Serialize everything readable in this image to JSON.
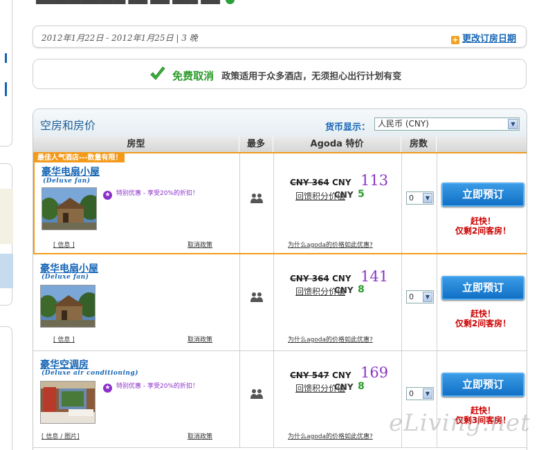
{
  "top_strip": {
    "text": "██████████████ ███ ███ ████ ███"
  },
  "booking": {
    "date_range": "2012年1月22日 - 2012年1月25日 | 3 晚",
    "change_date_label": "更改订房日期"
  },
  "cancellation": {
    "title": "免费取消",
    "description": "政策适用于众多酒店，无须担心出行计划有变"
  },
  "rooms_panel": {
    "title": "空房和房价",
    "currency_label": "货币显示：",
    "currency_value": "人民币 (CNY)",
    "columns": [
      "房型",
      "最多",
      "Agoda 特价",
      "房数"
    ]
  },
  "rooms": [
    {
      "banner": "最佳人气酒店---数量有限！",
      "name": "豪华电扇小屋",
      "name_en": "(Deluxe fan)",
      "promo": "特别优惠 - 享受20%的折扣！",
      "info": "[ 信息 ]",
      "policy": "取消政策",
      "old_price_currency": "CNY",
      "old_price": "364",
      "price_currency": "CNY",
      "price": "113",
      "reward_label": "回馈积分价值",
      "reward_unit": "CNY",
      "reward_value": "5",
      "why_link": "为什么agoda的价格如此优惠?",
      "qty": "0",
      "book_label": "立即预订",
      "hurry_1": "赶快！",
      "hurry_2": "仅剩2间客房！"
    },
    {
      "name": "豪华电扇小屋",
      "name_en": "(Deluxe fan)",
      "info": "[ 信息 ]",
      "policy": "取消政策",
      "old_price_currency": "CNY",
      "old_price": "364",
      "price_currency": "CNY",
      "price": "141",
      "reward_label": "回馈积分价值",
      "reward_unit": "CNY",
      "reward_value": "8",
      "why_link": "为什么agoda的价格如此优惠?",
      "qty": "0",
      "book_label": "立即预订",
      "hurry_1": "赶快！",
      "hurry_2": "仅剩2间客房！"
    },
    {
      "name": "豪华空调房",
      "name_en": "(Deluxe air conditioning)",
      "promo": "特别优惠 - 享受20%的折扣！",
      "info": "[ 信息 / 图片]",
      "policy": "取消政策",
      "old_price_currency": "CNY",
      "old_price": "547",
      "price_currency": "CNY",
      "price": "169",
      "reward_label": "回馈积分价值",
      "reward_unit": "CNY",
      "reward_value": "8",
      "why_link": "为什么agoda的价格如此优惠?",
      "qty": "0",
      "book_label": "立即预订",
      "hurry_1": "赶快！",
      "hurry_2": "仅剩3间客房！"
    }
  ],
  "watermark": "eLiving.net",
  "colors": {
    "accent": "#1464b4",
    "featured_border": "#f39a1a",
    "price": "#8a35c6",
    "reward": "#2a9a2a",
    "urgent": "#cc0000"
  }
}
